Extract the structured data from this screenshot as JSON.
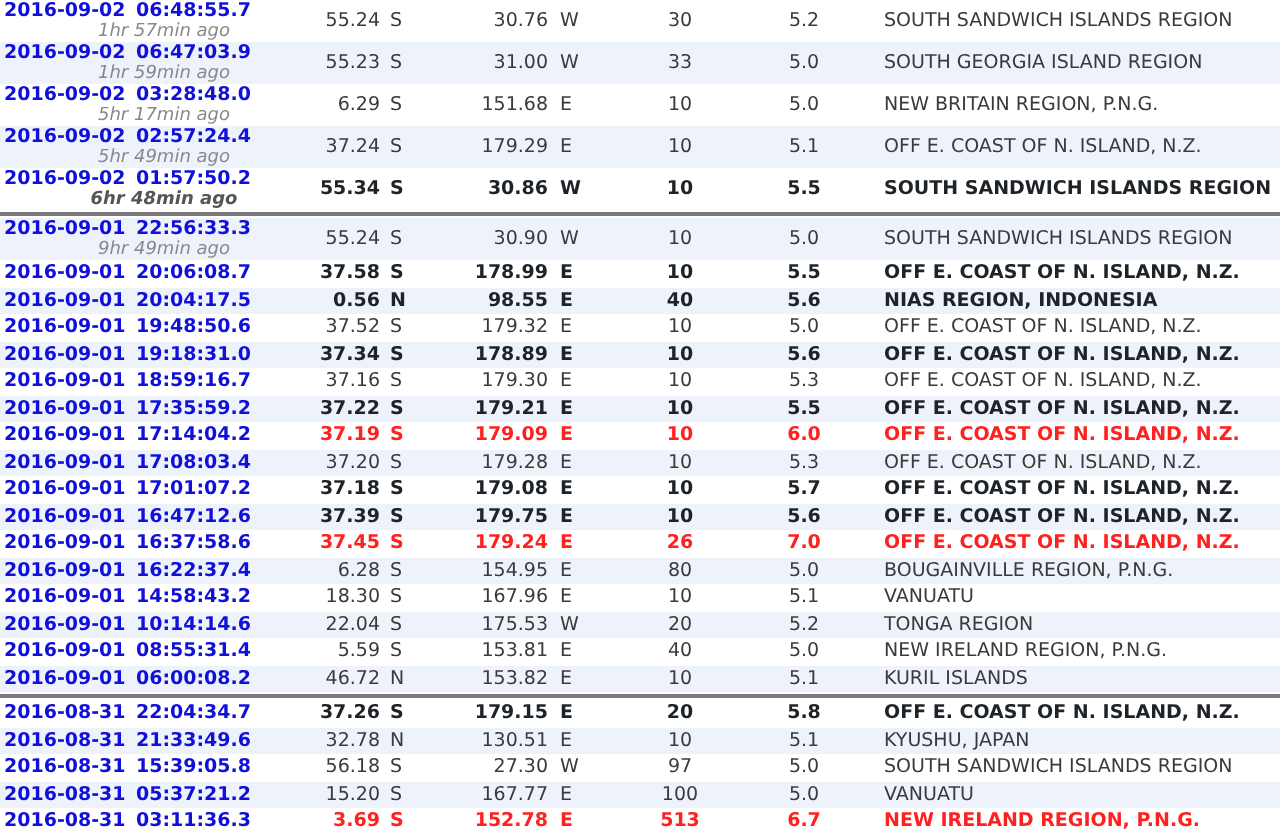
{
  "groups": [
    {
      "rows": [
        {
          "date": "2016-09-02",
          "time": "06:48:55.7",
          "ago": "1hr 57min ago",
          "lat": "55.24",
          "ns": "S",
          "lon": "30.76",
          "ew": "W",
          "depth": "30",
          "mag": "5.2",
          "region": "SOUTH SANDWICH ISLANDS REGION",
          "kind": "normal"
        },
        {
          "date": "2016-09-02",
          "time": "06:47:03.9",
          "ago": "1hr 59min ago",
          "lat": "55.23",
          "ns": "S",
          "lon": "31.00",
          "ew": "W",
          "depth": "33",
          "mag": "5.0",
          "region": "SOUTH GEORGIA ISLAND REGION",
          "kind": "normal"
        },
        {
          "date": "2016-09-02",
          "time": "03:28:48.0",
          "ago": "5hr 17min ago",
          "lat": "6.29",
          "ns": "S",
          "lon": "151.68",
          "ew": "E",
          "depth": "10",
          "mag": "5.0",
          "region": "NEW BRITAIN REGION, P.N.G.",
          "kind": "normal"
        },
        {
          "date": "2016-09-02",
          "time": "02:57:24.4",
          "ago": "5hr 49min ago",
          "lat": "37.24",
          "ns": "S",
          "lon": "179.29",
          "ew": "E",
          "depth": "10",
          "mag": "5.1",
          "region": "OFF E. COAST OF N. ISLAND, N.Z.",
          "kind": "normal"
        },
        {
          "date": "2016-09-02",
          "time": "01:57:50.2",
          "ago": "6hr 48min ago",
          "lat": "55.34",
          "ns": "S",
          "lon": "30.86",
          "ew": "W",
          "depth": "10",
          "mag": "5.5",
          "region": "SOUTH SANDWICH ISLANDS REGION",
          "kind": "strong"
        }
      ]
    },
    {
      "rows": [
        {
          "date": "2016-09-01",
          "time": "22:56:33.3",
          "ago": "9hr 49min ago",
          "lat": "55.24",
          "ns": "S",
          "lon": "30.90",
          "ew": "W",
          "depth": "10",
          "mag": "5.0",
          "region": "SOUTH SANDWICH ISLANDS REGION",
          "kind": "normal"
        },
        {
          "date": "2016-09-01",
          "time": "20:06:08.7",
          "lat": "37.58",
          "ns": "S",
          "lon": "178.99",
          "ew": "E",
          "depth": "10",
          "mag": "5.5",
          "region": "OFF E. COAST OF N. ISLAND, N.Z.",
          "kind": "strong"
        },
        {
          "date": "2016-09-01",
          "time": "20:04:17.5",
          "lat": "0.56",
          "ns": "N",
          "lon": "98.55",
          "ew": "E",
          "depth": "40",
          "mag": "5.6",
          "region": "NIAS REGION, INDONESIA",
          "kind": "strong"
        },
        {
          "date": "2016-09-01",
          "time": "19:48:50.6",
          "lat": "37.52",
          "ns": "S",
          "lon": "179.32",
          "ew": "E",
          "depth": "10",
          "mag": "5.0",
          "region": "OFF E. COAST OF N. ISLAND, N.Z.",
          "kind": "normal"
        },
        {
          "date": "2016-09-01",
          "time": "19:18:31.0",
          "lat": "37.34",
          "ns": "S",
          "lon": "178.89",
          "ew": "E",
          "depth": "10",
          "mag": "5.6",
          "region": "OFF E. COAST OF N. ISLAND, N.Z.",
          "kind": "strong"
        },
        {
          "date": "2016-09-01",
          "time": "18:59:16.7",
          "lat": "37.16",
          "ns": "S",
          "lon": "179.30",
          "ew": "E",
          "depth": "10",
          "mag": "5.3",
          "region": "OFF E. COAST OF N. ISLAND, N.Z.",
          "kind": "normal"
        },
        {
          "date": "2016-09-01",
          "time": "17:35:59.2",
          "lat": "37.22",
          "ns": "S",
          "lon": "179.21",
          "ew": "E",
          "depth": "10",
          "mag": "5.5",
          "region": "OFF E. COAST OF N. ISLAND, N.Z.",
          "kind": "strong"
        },
        {
          "date": "2016-09-01",
          "time": "17:14:04.2",
          "lat": "37.19",
          "ns": "S",
          "lon": "179.09",
          "ew": "E",
          "depth": "10",
          "mag": "6.0",
          "region": "OFF E. COAST OF N. ISLAND, N.Z.",
          "kind": "major"
        },
        {
          "date": "2016-09-01",
          "time": "17:08:03.4",
          "lat": "37.20",
          "ns": "S",
          "lon": "179.28",
          "ew": "E",
          "depth": "10",
          "mag": "5.3",
          "region": "OFF E. COAST OF N. ISLAND, N.Z.",
          "kind": "normal"
        },
        {
          "date": "2016-09-01",
          "time": "17:01:07.2",
          "lat": "37.18",
          "ns": "S",
          "lon": "179.08",
          "ew": "E",
          "depth": "10",
          "mag": "5.7",
          "region": "OFF E. COAST OF N. ISLAND, N.Z.",
          "kind": "strong"
        },
        {
          "date": "2016-09-01",
          "time": "16:47:12.6",
          "lat": "37.39",
          "ns": "S",
          "lon": "179.75",
          "ew": "E",
          "depth": "10",
          "mag": "5.6",
          "region": "OFF E. COAST OF N. ISLAND, N.Z.",
          "kind": "strong"
        },
        {
          "date": "2016-09-01",
          "time": "16:37:58.6",
          "lat": "37.45",
          "ns": "S",
          "lon": "179.24",
          "ew": "E",
          "depth": "26",
          "mag": "7.0",
          "region": "OFF E. COAST OF N. ISLAND, N.Z.",
          "kind": "major"
        },
        {
          "date": "2016-09-01",
          "time": "16:22:37.4",
          "lat": "6.28",
          "ns": "S",
          "lon": "154.95",
          "ew": "E",
          "depth": "80",
          "mag": "5.0",
          "region": "BOUGAINVILLE REGION, P.N.G.",
          "kind": "normal"
        },
        {
          "date": "2016-09-01",
          "time": "14:58:43.2",
          "lat": "18.30",
          "ns": "S",
          "lon": "167.96",
          "ew": "E",
          "depth": "10",
          "mag": "5.1",
          "region": "VANUATU",
          "kind": "normal"
        },
        {
          "date": "2016-09-01",
          "time": "10:14:14.6",
          "lat": "22.04",
          "ns": "S",
          "lon": "175.53",
          "ew": "W",
          "depth": "20",
          "mag": "5.2",
          "region": "TONGA REGION",
          "kind": "normal"
        },
        {
          "date": "2016-09-01",
          "time": "08:55:31.4",
          "lat": "5.59",
          "ns": "S",
          "lon": "153.81",
          "ew": "E",
          "depth": "40",
          "mag": "5.0",
          "region": "NEW IRELAND REGION, P.N.G.",
          "kind": "normal"
        },
        {
          "date": "2016-09-01",
          "time": "06:00:08.2",
          "lat": "46.72",
          "ns": "N",
          "lon": "153.82",
          "ew": "E",
          "depth": "10",
          "mag": "5.1",
          "region": "KURIL ISLANDS",
          "kind": "normal"
        }
      ]
    },
    {
      "rows": [
        {
          "date": "2016-08-31",
          "time": "22:04:34.7",
          "lat": "37.26",
          "ns": "S",
          "lon": "179.15",
          "ew": "E",
          "depth": "20",
          "mag": "5.8",
          "region": "OFF E. COAST OF N. ISLAND, N.Z.",
          "kind": "strong"
        },
        {
          "date": "2016-08-31",
          "time": "21:33:49.6",
          "lat": "32.78",
          "ns": "N",
          "lon": "130.51",
          "ew": "E",
          "depth": "10",
          "mag": "5.1",
          "region": "KYUSHU, JAPAN",
          "kind": "normal"
        },
        {
          "date": "2016-08-31",
          "time": "15:39:05.8",
          "lat": "56.18",
          "ns": "S",
          "lon": "27.30",
          "ew": "W",
          "depth": "97",
          "mag": "5.0",
          "region": "SOUTH SANDWICH ISLANDS REGION",
          "kind": "normal"
        },
        {
          "date": "2016-08-31",
          "time": "05:37:21.2",
          "lat": "15.20",
          "ns": "S",
          "lon": "167.77",
          "ew": "E",
          "depth": "100",
          "mag": "5.0",
          "region": "VANUATU",
          "kind": "normal"
        },
        {
          "date": "2016-08-31",
          "time": "03:11:36.3",
          "lat": "3.69",
          "ns": "S",
          "lon": "152.78",
          "ew": "E",
          "depth": "513",
          "mag": "6.7",
          "region": "NEW IRELAND REGION, P.N.G.",
          "kind": "major"
        }
      ]
    }
  ]
}
